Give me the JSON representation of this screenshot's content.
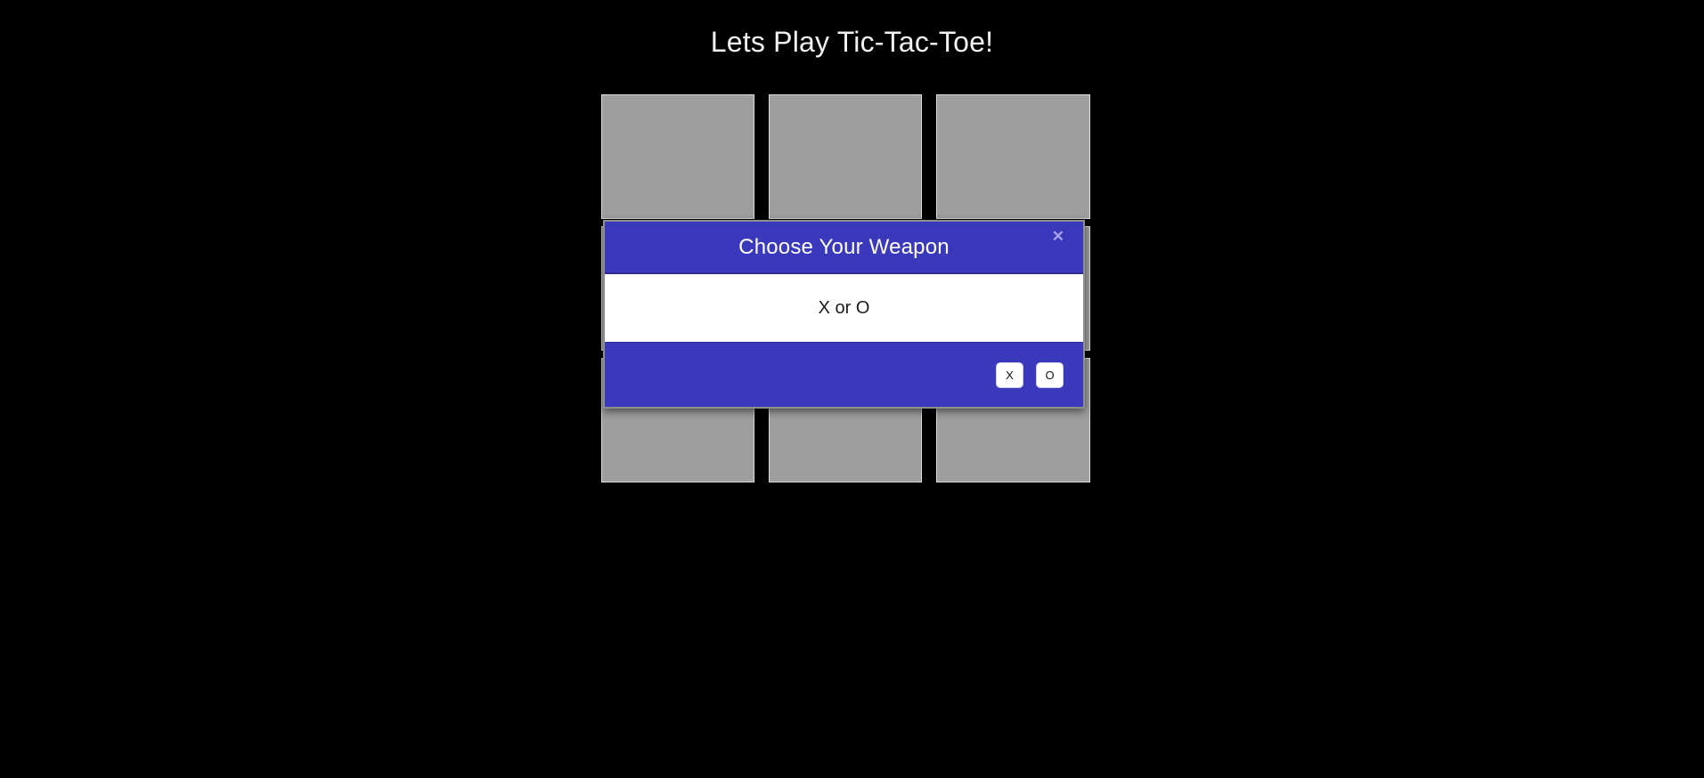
{
  "page": {
    "title": "Lets Play Tic-Tac-Toe!",
    "background_color": "#000000",
    "title_color": "#f2f2f2"
  },
  "board": {
    "cell_color": "#9e9e9e",
    "cell_border_color": "#dcdcdc",
    "rows": [
      {
        "cells": [
          {
            "label": ""
          },
          {
            "label": ""
          },
          {
            "label": ""
          }
        ]
      },
      {
        "cells": [
          {
            "label": ""
          },
          {
            "label": ""
          },
          {
            "label": ""
          }
        ]
      },
      {
        "cells": [
          {
            "label": ""
          },
          {
            "label": ""
          },
          {
            "label": ""
          }
        ]
      }
    ]
  },
  "modal": {
    "accent_color": "#3b39bb",
    "title": "Choose Your Weapon",
    "close_label": "✕",
    "body_text": "X or O",
    "buttons": [
      {
        "label": "X"
      },
      {
        "label": "O"
      }
    ]
  }
}
